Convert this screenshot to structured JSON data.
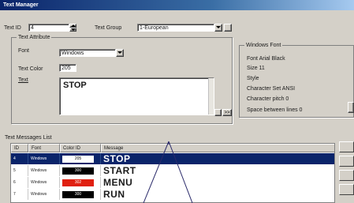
{
  "window": {
    "title": "Text Manager"
  },
  "top": {
    "text_id_label": "Text ID",
    "text_id_value": "4",
    "text_group_label": "Text Group",
    "text_group_value": "1-European"
  },
  "attribute": {
    "title": "Text Attribute",
    "font_label": "Font",
    "font_value": "Windows",
    "color_label": "Text Color",
    "color_value": "205",
    "text_label": "Text",
    "text_value": "STOP",
    "more_button": ">>"
  },
  "windows_font": {
    "title": "Windows Font",
    "lines": [
      "Font    Arial Black",
      "Size    11",
      "Style",
      "Character Set    ANSI",
      "Character pitch    0",
      "Space between lines    0"
    ]
  },
  "list": {
    "title": "Text Messages List",
    "columns": [
      "ID",
      "Font",
      "Color ID",
      "Message"
    ],
    "rows": [
      {
        "id": "4",
        "font": "Windows",
        "color_id": "205",
        "swatch_color": "#ffffff",
        "swatch_text": "#000000",
        "message": "STOP",
        "selected": true
      },
      {
        "id": "5",
        "font": "Windows",
        "color_id": "300",
        "swatch_color": "#000000",
        "swatch_text": "#ffffff",
        "message": "START",
        "selected": false
      },
      {
        "id": "6",
        "font": "Windows",
        "color_id": "302",
        "swatch_color": "#e02010",
        "swatch_text": "#ffffff",
        "message": "MENU",
        "selected": false
      },
      {
        "id": "7",
        "font": "Windows",
        "color_id": "300",
        "swatch_color": "#000000",
        "swatch_text": "#ffffff",
        "message": "RUN",
        "selected": false
      }
    ]
  },
  "colors": {
    "selection": "#0a246a",
    "face": "#d4d0c8"
  }
}
